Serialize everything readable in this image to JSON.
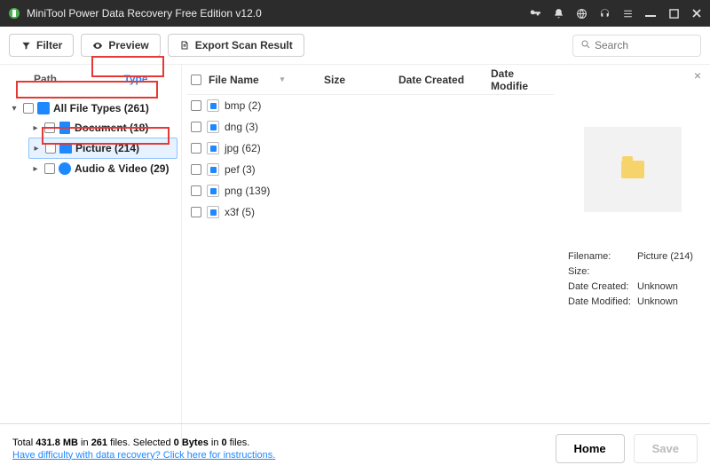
{
  "titlebar": {
    "title": "MiniTool Power Data Recovery Free Edition v12.0"
  },
  "toolbar": {
    "filter": "Filter",
    "preview": "Preview",
    "export": "Export Scan Result",
    "search_placeholder": "Search"
  },
  "sidebar": {
    "tabs": {
      "path": "Path",
      "type": "Type"
    },
    "root": "All File Types (261)",
    "items": [
      "Document (18)",
      "Picture (214)",
      "Audio & Video (29)"
    ]
  },
  "columns": {
    "name": "File Name",
    "size": "Size",
    "dc": "Date Created",
    "dm": "Date Modifie"
  },
  "rows": [
    "bmp (2)",
    "dng (3)",
    "jpg (62)",
    "pef (3)",
    "png (139)",
    "x3f (5)"
  ],
  "preview": {
    "filename_k": "Filename:",
    "filename_v": "Picture (214)",
    "size_k": "Size:",
    "size_v": "",
    "dc_k": "Date Created:",
    "dc_v": "Unknown",
    "dm_k": "Date Modified:",
    "dm_v": "Unknown"
  },
  "footer": {
    "total_pre": "Total ",
    "total_size": "431.8 MB",
    "total_mid": " in ",
    "total_files": "261",
    "total_suf": " files.",
    "sel_pre": "   Selected ",
    "sel_size": "0 Bytes",
    "sel_mid": " in ",
    "sel_files": "0",
    "sel_suf": " files.",
    "help": "Have difficulty with data recovery? Click here for instructions.",
    "home": "Home",
    "save": "Save"
  }
}
